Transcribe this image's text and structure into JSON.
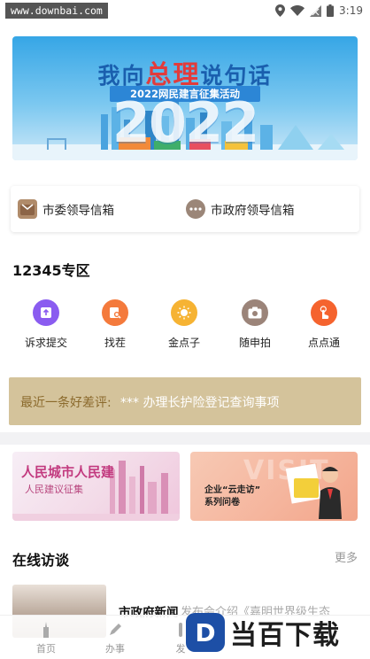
{
  "statusbar": {
    "watermark_url": "www.downbai.com",
    "time": "3:19"
  },
  "banner": {
    "title_a": "我向",
    "title_highlight": "总理",
    "title_b": "说句话",
    "subtitle": "2022网民建言征集活动",
    "year": "2022"
  },
  "mailbox": {
    "items": [
      {
        "label": "市委领导信箱",
        "icon": "envelope-icon"
      },
      {
        "label": "市政府领导信箱",
        "icon": "chat-bubble-icon"
      }
    ]
  },
  "section_12345": {
    "title": "12345专区",
    "items": [
      {
        "label": "诉求提交",
        "icon": "upload-icon",
        "color": "#8a5cf0"
      },
      {
        "label": "找茬",
        "icon": "search-doc-icon",
        "color": "#f47a3c"
      },
      {
        "label": "金点子",
        "icon": "lightbulb-icon",
        "color": "#f6b333"
      },
      {
        "label": "随申拍",
        "icon": "camera-icon",
        "color": "#9b8479"
      },
      {
        "label": "点点通",
        "icon": "tap-icon",
        "color": "#f5632e"
      }
    ]
  },
  "eval_bar": {
    "prefix": "最近一条好差评:",
    "text": "*** 办理长护险登记查询事项"
  },
  "promos": {
    "left": {
      "title": "人民城市人民建",
      "subtitle": "人民建议征集"
    },
    "right": {
      "line1": "企业“云走访”",
      "line2": "系列问卷",
      "watermark": "VISIT"
    }
  },
  "online": {
    "title": "在线访谈",
    "more": "更多"
  },
  "news": {
    "title": "市政府新闻",
    "snippet": "发布会介绍《嘉明世界级生态"
  },
  "tabbar": {
    "items": [
      {
        "label": "首页",
        "icon": "home-tower-icon"
      },
      {
        "label": "办事",
        "icon": "pen-icon"
      },
      {
        "label": "发",
        "icon": "bell-icon"
      }
    ]
  },
  "brand": {
    "badge": "D",
    "text": "当百下载"
  },
  "colors": {
    "eval_bar_bg": "#d4c39b",
    "banner_blue": "#1a5fae",
    "banner_red": "#e23b3b"
  }
}
